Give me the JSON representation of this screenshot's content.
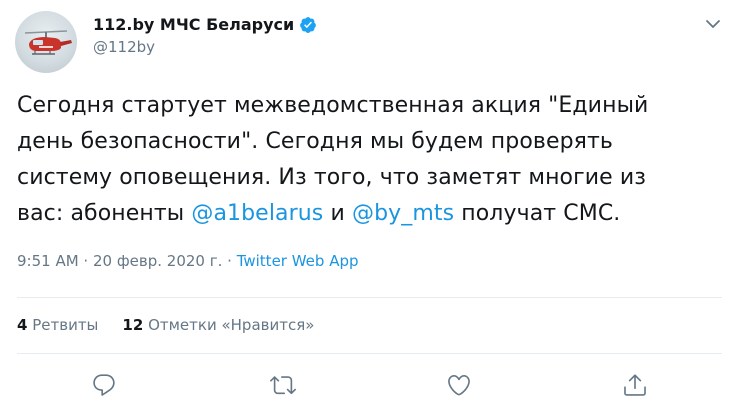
{
  "author": {
    "display_name": "112.by МЧС Беларуси",
    "handle": "@112by",
    "avatar_icon": "helicopter-avatar",
    "verified_icon": "verified-badge-icon"
  },
  "tweet": {
    "line1": "Сегодня стартует межведомственная акция \"Единый",
    "line2": "день безопасности\". Сегодня мы будем проверять",
    "line3": "систему оповещения. Из того, что заметят многие из",
    "line4_prefix": "вас: абоненты ",
    "mention1": "@a1belarus",
    "line4_mid": " и ",
    "mention2": "@by_mts",
    "line4_suffix": " получат СМС."
  },
  "meta": {
    "time": "9:51 AM",
    "sep1": " · ",
    "date": "20 февр. 2020 г.",
    "sep2": " · ",
    "source": "Twitter Web App"
  },
  "stats": {
    "retweets_count": "4",
    "retweets_label": "Ретвиты",
    "likes_count": "12",
    "likes_label": "Отметки «Нравится»"
  },
  "actions": [
    "reply-icon",
    "retweet-icon",
    "like-icon",
    "share-icon"
  ],
  "colors": {
    "link": "#1b95e0",
    "secondary_text": "#657786",
    "primary_text": "#14171a",
    "divider": "#e6ecf0"
  }
}
